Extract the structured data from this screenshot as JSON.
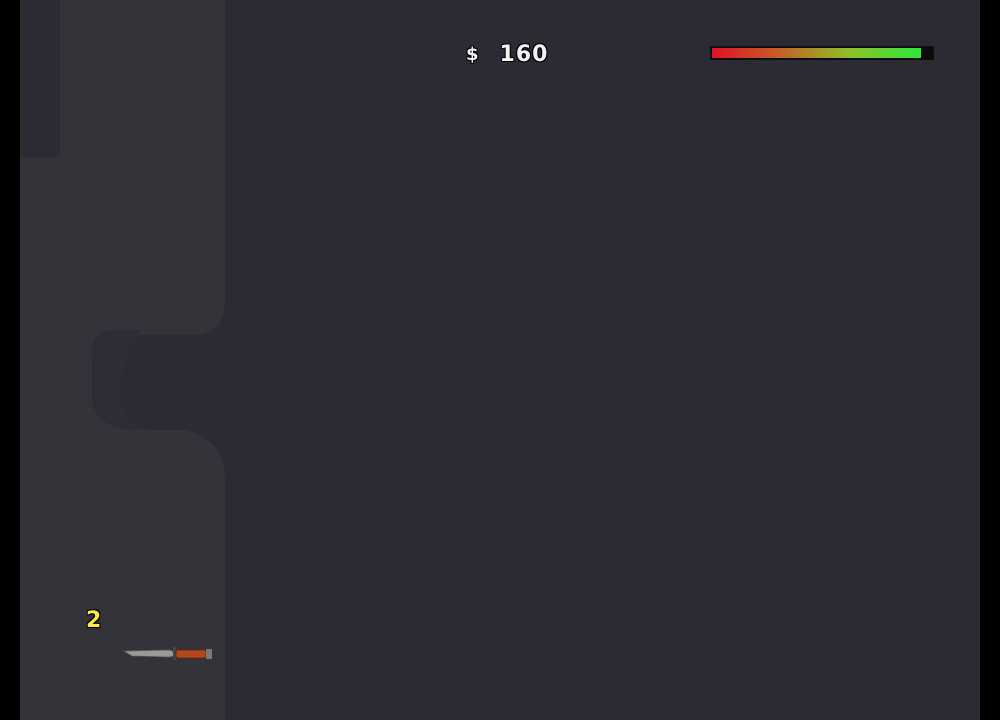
{
  "hud": {
    "currency_symbol": "$",
    "money": "160",
    "health_fraction": 0.95,
    "health_colors": {
      "low": "#e0102a",
      "high": "#2ee83a",
      "track": "#0b0b0b"
    },
    "ammo": "2",
    "ammo_color": "#ffe84a",
    "weapon_icon": "combat-knife-icon"
  },
  "scene": {
    "floor_color": "#2b2b33",
    "terrain_color": "#33333a",
    "shadow_color": "#2a2a32"
  }
}
